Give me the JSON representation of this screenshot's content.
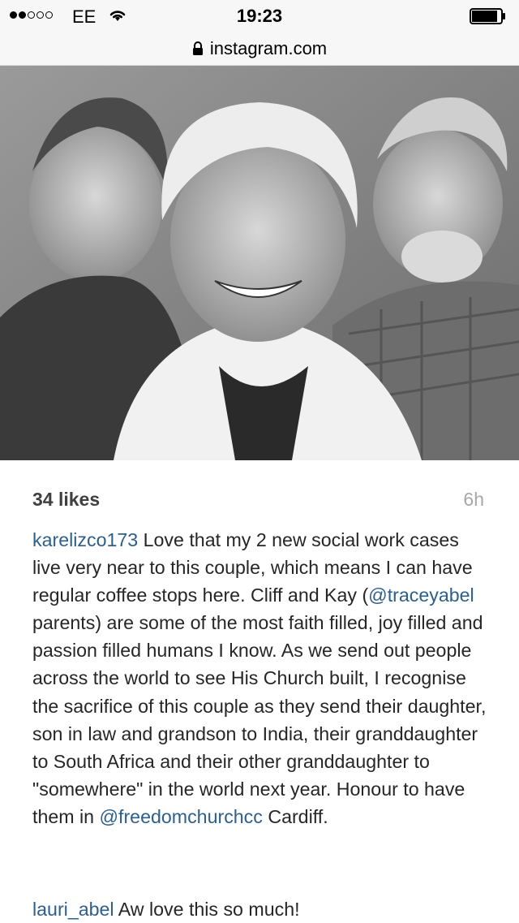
{
  "status_bar": {
    "signal_filled": 2,
    "signal_total": 5,
    "carrier": "EE",
    "time": "19:23",
    "wifi_icon": "wifi-icon",
    "battery_icon": "battery-icon"
  },
  "browser": {
    "url": "instagram.com",
    "lock_icon": "lock-icon"
  },
  "post": {
    "photo_icon": "photo",
    "likes": "34 likes",
    "age": "6h",
    "caption": {
      "username": "karelizco173",
      "text_1": " Love that my 2 new social work cases live very near to this couple, which means I can have regular coffee stops here. Cliff and Kay (",
      "mention_1": "@traceyabel",
      "text_2": " parents) are some of the most faith filled, joy filled and passion filled humans I know. As we send out people across the world to see His Church built, I recognise the sacrifice of this couple as they send their daughter, son in law and grandson to India, their granddaughter to South Africa and their other granddaughter to \"somewhere\" in the world next year. Honour to have them in ",
      "mention_2": "@freedomchurchcc",
      "text_3": " Cardiff."
    },
    "comments": [
      {
        "username": "lauri_abel",
        "text": " Aw love this so much!"
      }
    ]
  }
}
